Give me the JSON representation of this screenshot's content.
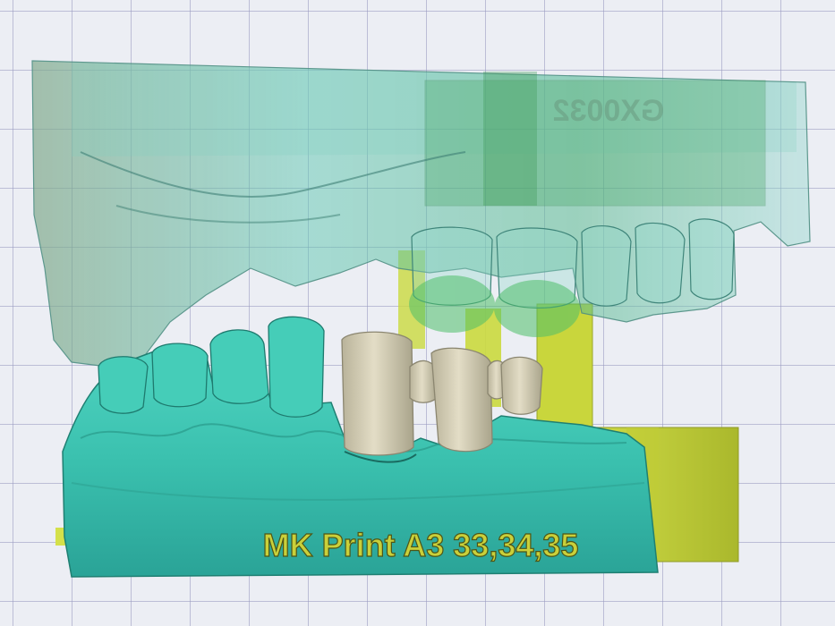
{
  "model": {
    "lower_label": "MK Print A3 33,34,35",
    "upper_label": "GX0032",
    "colors": {
      "lower_model": "#3fc9b4",
      "upper_model": "#6fd1bd",
      "crowns": "#d9d3bc",
      "support_base": "#c9d938",
      "grid_background": "#eceef4",
      "grid_lines": "#9696be",
      "label_text": "#c9d03a"
    }
  }
}
